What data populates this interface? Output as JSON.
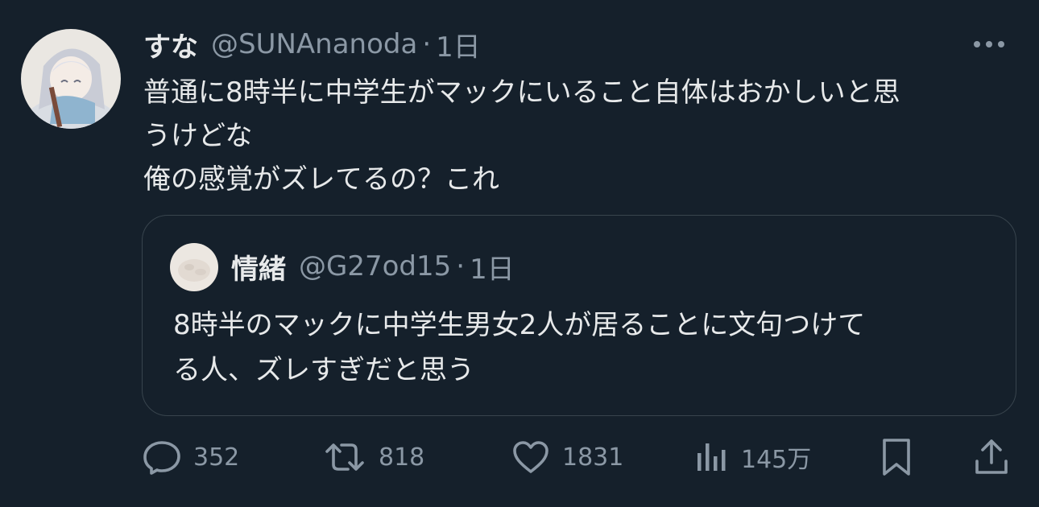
{
  "post": {
    "author": {
      "display_name": "すな",
      "handle": "@SUNAnanoda",
      "separator": "·",
      "time": "1日"
    },
    "text_lines": [
      "普通に8時半に中学生がマックにいること自体はおかしいと思",
      "うけどな",
      "俺の感覚がズレてるの？これ"
    ],
    "more_icon": "more-dots-icon"
  },
  "quoted": {
    "author": {
      "display_name": "情緒",
      "handle": "@G27od15",
      "separator": "·",
      "time": "1日"
    },
    "text_lines": [
      "8時半のマックに中学生男女2人が居ることに文句つけて",
      "る人、ズレすぎだと思う"
    ]
  },
  "actions": {
    "reply": {
      "icon": "reply-icon",
      "count": "352"
    },
    "repost": {
      "icon": "repost-icon",
      "count": "818"
    },
    "like": {
      "icon": "heart-icon",
      "count": "1831"
    },
    "views": {
      "icon": "views-icon",
      "count": "145万"
    },
    "bookmark": {
      "icon": "bookmark-icon"
    },
    "share": {
      "icon": "share-icon"
    }
  },
  "colors": {
    "background": "#15202b",
    "text_primary": "#e7e9ea",
    "text_secondary": "#8b98a5",
    "border": "#38444d"
  }
}
